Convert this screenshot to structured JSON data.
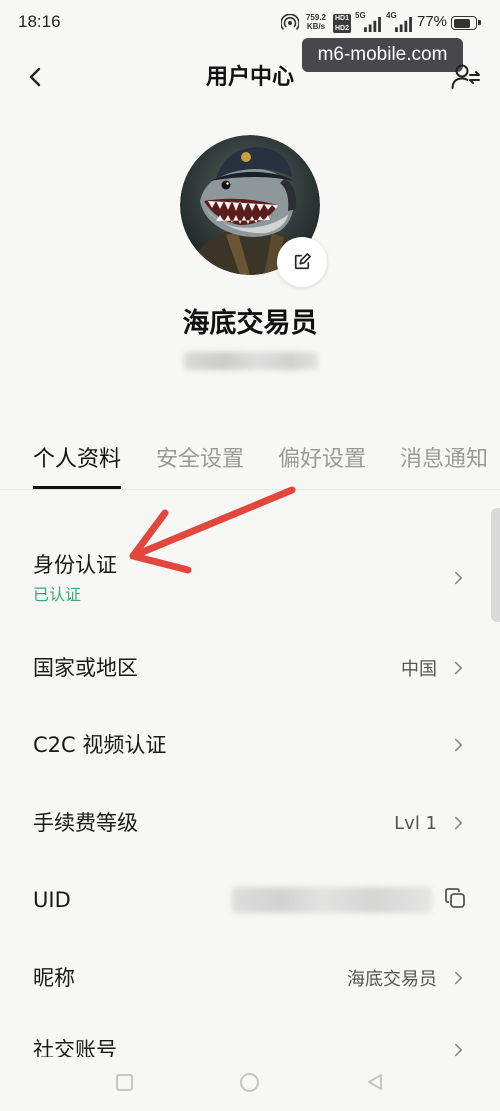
{
  "status_bar": {
    "time": "18:16",
    "speed_value": "759.2",
    "speed_unit": "KB/s",
    "hd_1": "HD1",
    "hd_2": "HD2",
    "network_1": "5G",
    "network_2": "4G",
    "battery_percent": "77%",
    "battery_level": 0.77
  },
  "watermark": "m6-mobile.com",
  "header": {
    "title": "用户中心"
  },
  "profile": {
    "nickname": "海底交易员"
  },
  "tabs": [
    {
      "label": "个人资料",
      "active": true
    },
    {
      "label": "安全设置",
      "active": false
    },
    {
      "label": "偏好设置",
      "active": false
    },
    {
      "label": "消息通知",
      "active": false
    }
  ],
  "list": [
    {
      "label": "身份认证",
      "status": "已认证"
    },
    {
      "label": "国家或地区",
      "value": "中国"
    },
    {
      "label": "C2C 视频认证"
    },
    {
      "label": "手续费等级",
      "value": "Lvl 1"
    },
    {
      "label": "UID"
    },
    {
      "label": "昵称",
      "value": "海底交易员"
    },
    {
      "label": "社交账号"
    }
  ],
  "colors": {
    "background": "#f7f7f5",
    "text_primary": "#1a1a1a",
    "text_inactive": "#9a9a9a",
    "verified_green": "#3aa878",
    "annotation_red": "#e2463c"
  },
  "icons": {
    "back": "chevron-left-icon",
    "account": "switch-account-icon",
    "edit_avatar": "edit-icon",
    "row_arrow": "chevron-right-icon",
    "copy": "copy-icon",
    "nav_recent": "square-icon",
    "nav_home": "circle-icon",
    "nav_back": "triangle-back-icon"
  }
}
